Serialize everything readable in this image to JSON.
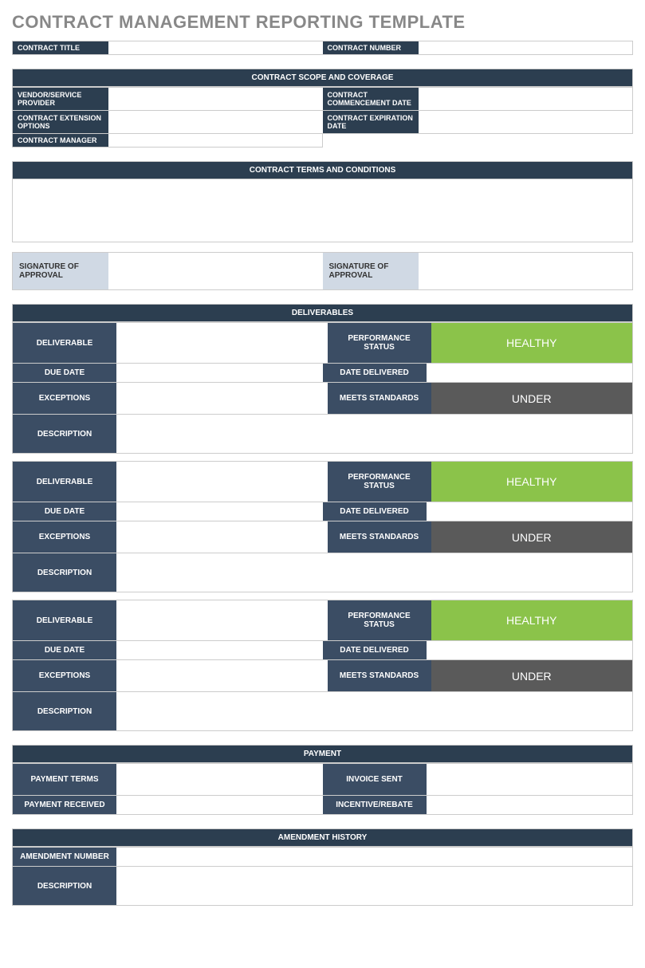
{
  "title": "CONTRACT MANAGEMENT REPORTING TEMPLATE",
  "top": {
    "contract_title": "CONTRACT TITLE",
    "contract_number": "CONTRACT NUMBER"
  },
  "scope": {
    "header": "CONTRACT SCOPE AND COVERAGE",
    "vendor": "VENDOR/SERVICE PROVIDER",
    "commencement": "CONTRACT COMMENCEMENT DATE",
    "extension": "CONTRACT EXTENSION OPTIONS",
    "expiration": "CONTRACT EXPIRATION DATE",
    "manager": "CONTRACT MANAGER"
  },
  "terms": {
    "header": "CONTRACT TERMS AND CONDITIONS",
    "sig1": "SIGNATURE OF APPROVAL",
    "sig2": "SIGNATURE OF APPROVAL"
  },
  "deliverables": {
    "header": "DELIVERABLES",
    "labels": {
      "deliverable": "DELIVERABLE",
      "performance": "PERFORMANCE STATUS",
      "due_date": "DUE DATE",
      "date_delivered": "DATE DELIVERED",
      "exceptions": "EXCEPTIONS",
      "meets_standards": "MEETS STANDARDS",
      "description": "DESCRIPTION"
    },
    "items": [
      {
        "performance_status": "HEALTHY",
        "meets_standards": "UNDER"
      },
      {
        "performance_status": "HEALTHY",
        "meets_standards": "UNDER"
      },
      {
        "performance_status": "HEALTHY",
        "meets_standards": "UNDER"
      }
    ]
  },
  "payment": {
    "header": "PAYMENT",
    "terms": "PAYMENT TERMS",
    "invoice": "INVOICE SENT",
    "received": "PAYMENT RECEIVED",
    "incentive": "INCENTIVE/REBATE"
  },
  "amendment": {
    "header": "AMENDMENT HISTORY",
    "number": "AMENDMENT NUMBER",
    "description": "DESCRIPTION"
  }
}
